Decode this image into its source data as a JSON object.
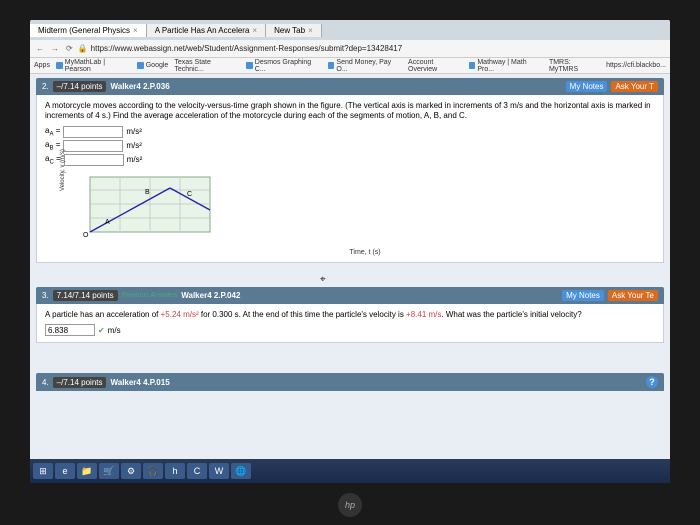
{
  "tabs": [
    {
      "title": "Midterm (General Physics",
      "close": "×"
    },
    {
      "title": "A Particle Has An Accelera",
      "close": "×"
    },
    {
      "title": "New Tab",
      "close": "×"
    }
  ],
  "url": "https://www.webassign.net/web/Student/Assignment-Responses/submit?dep=13428417",
  "bookmarks": [
    "MyMathLab | Pearson",
    "Google",
    "Texas State Technic...",
    "Desmos Graphing C...",
    "Send Money, Pay O...",
    "Account Overview",
    "Mathway | Math Pro...",
    "TMRS: MyTMRS",
    "https://cfi.blackbo..."
  ],
  "apps_label": "Apps",
  "q2": {
    "num": "2.",
    "pts": "–/7.14 points",
    "ref": "Walker4 2.P.036",
    "mynotes": "My Notes",
    "ask": "Ask Your T",
    "text": "A motorcycle moves according to the velocity-versus-time graph shown in the figure. (The vertical axis is marked in increments of 3 m/s and the horizontal axis is marked in increments of 4 s.) Find the average acceleration of the motorcycle during each of the segments of motion, A, B, and C.",
    "rows": [
      {
        "label": "a",
        "sub": "A",
        "unit": "m/s²"
      },
      {
        "label": "a",
        "sub": "B",
        "unit": "m/s²"
      },
      {
        "label": "a",
        "sub": "C",
        "unit": "m/s²"
      }
    ],
    "graph": {
      "ylabel": "Velocity, v (m/s)",
      "xlabel": "Time, t (s)",
      "segA": "A",
      "segB": "B",
      "segC": "C",
      "origin": "O"
    }
  },
  "q3": {
    "num": "3.",
    "pts": "7.14/7.14 points",
    "prev": "Previous Answers",
    "ref": "Walker4 2.P.042",
    "mynotes": "My Notes",
    "ask": "Ask Your Te",
    "text_pre": "A particle has an acceleration of ",
    "accel": "+5.24 m/s²",
    "text_mid": " for 0.300 s. At the end of this time the particle's velocity is ",
    "vel": "+8.41 m/s",
    "text_post": ". What was the particle's initial velocity?",
    "answer": "6.838",
    "unit": "m/s"
  },
  "q4": {
    "num": "4.",
    "pts": "–/7.14 points",
    "ref": "Walker4 4.P.015",
    "help": "?"
  },
  "chart_data": {
    "type": "line",
    "title": "",
    "xlabel": "Time, t (s)",
    "ylabel": "Velocity, v (m/s)",
    "x_tick_increment": 4,
    "y_tick_increment": 3,
    "xlim": [
      0,
      24
    ],
    "ylim": [
      0,
      15
    ],
    "points": [
      {
        "t": 0,
        "v": 0
      },
      {
        "t": 8,
        "v": 6
      },
      {
        "t": 16,
        "v": 12
      },
      {
        "t": 24,
        "v": 6
      }
    ],
    "segment_labels": {
      "A": [
        4,
        3
      ],
      "B": [
        12,
        9
      ],
      "C": [
        20,
        9
      ]
    }
  },
  "taskbar_icons": [
    "⊞",
    "e",
    "📁",
    "🛒",
    "⚙",
    "🎧",
    "h",
    "C",
    "W",
    "🌐"
  ]
}
